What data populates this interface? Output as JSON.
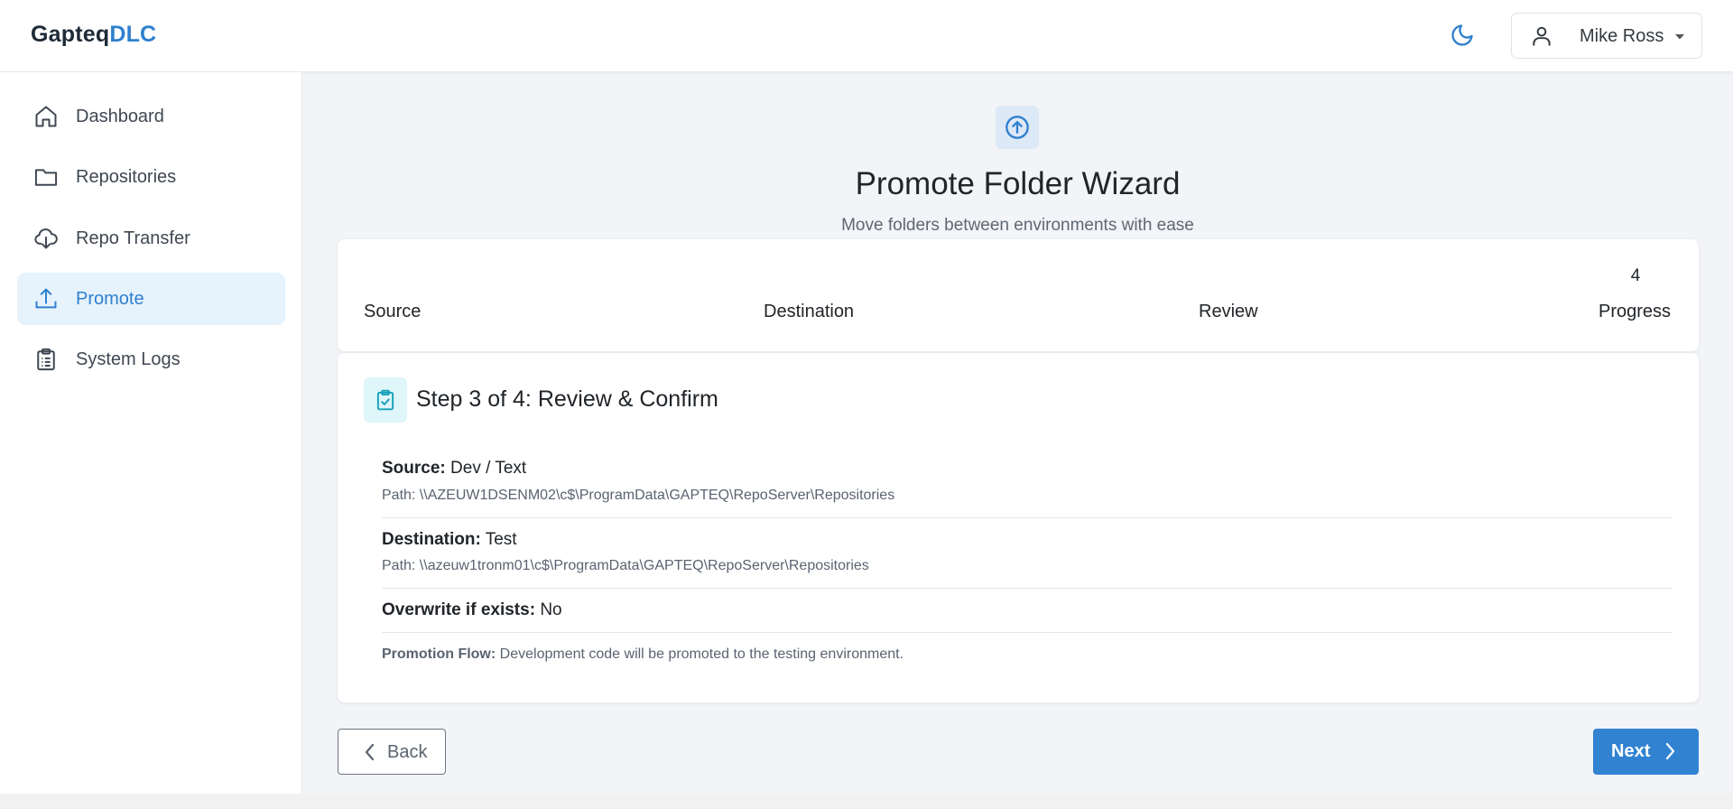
{
  "app": {
    "brand_main": "Gapteq",
    "brand_accent": "DLC",
    "accent_color": "#2f80ce"
  },
  "header": {
    "theme_toggle_icon": "moon-icon",
    "user_name": "Mike Ross",
    "user_icon": "user-icon",
    "caret_icon": "caret-down-icon"
  },
  "sidebar": {
    "items": [
      {
        "label": "Dashboard",
        "icon": "home-icon",
        "active": false
      },
      {
        "label": "Repositories",
        "icon": "folder-icon",
        "active": false
      },
      {
        "label": "Repo Transfer",
        "icon": "cloud-download-icon",
        "active": false
      },
      {
        "label": "Promote",
        "icon": "upload-icon",
        "active": true
      },
      {
        "label": "System Logs",
        "icon": "clipboard-icon",
        "active": false
      }
    ]
  },
  "wizard": {
    "icon": "arrow-up-circle-icon",
    "title": "Promote Folder Wizard",
    "subtitle": "Move folders between environments with ease",
    "steps": [
      {
        "label": "Source"
      },
      {
        "label": "Destination"
      },
      {
        "label": "Review"
      },
      {
        "number": "4",
        "label": "Progress"
      }
    ],
    "current_step_title": "Step 3 of 4: Review & Confirm",
    "current_step_icon": "clipboard-check-icon"
  },
  "review": {
    "source_label": "Source:",
    "source_value": "Dev / Text",
    "source_path": "Path: \\\\AZEUW1DSENM02\\c$\\ProgramData\\GAPTEQ\\RepoServer\\Repositories",
    "destination_label": "Destination:",
    "destination_value": "Test",
    "destination_path": "Path: \\\\azeuw1tronm01\\c$\\ProgramData\\GAPTEQ\\RepoServer\\Repositories",
    "overwrite_label": "Overwrite if exists:",
    "overwrite_value": "No",
    "flow_label": "Promotion Flow:",
    "flow_text": "Development code will be promoted to the testing environment."
  },
  "actions": {
    "back_label": "Back",
    "next_label": "Next"
  }
}
